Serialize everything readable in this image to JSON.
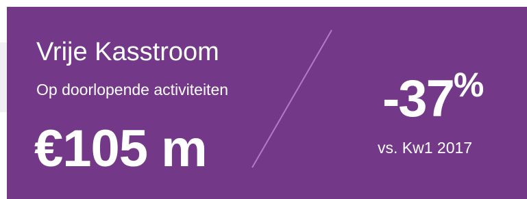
{
  "card": {
    "title": "Vrije Kasstroom",
    "subtitle": "Op doorlopende activiteiten",
    "amount": "€105 m",
    "change_value": "-37",
    "change_unit": "%",
    "comparison": "vs. Kw1 2017"
  },
  "colors": {
    "background": "#743889",
    "divider": "#b07cc6",
    "text": "#ffffff"
  }
}
